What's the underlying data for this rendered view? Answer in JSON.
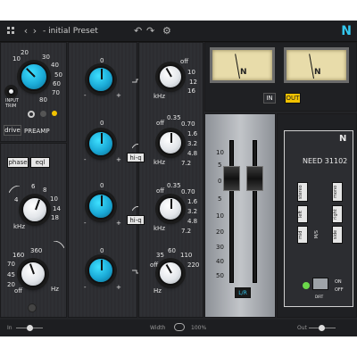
{
  "topbar": {
    "back_icon": "chevron-left",
    "forward_icon": "chevron-right",
    "preset_name": "- initial Preset",
    "undo_icon": "undo",
    "redo_icon": "redo",
    "settings_icon": "gear",
    "logo": "N"
  },
  "preamp": {
    "knob_ticks": [
      "10",
      "20",
      "30",
      "40",
      "50",
      "60",
      "70",
      "80"
    ],
    "input_trim_label": "INPUT\nTRIM",
    "drive_label": "drive",
    "preamp_label": "PREAMP"
  },
  "tone": {
    "phase_label": "phase",
    "eql_label": "eql",
    "hp_ticks": [
      "6",
      "8",
      "10",
      "14",
      "18",
      "4"
    ],
    "hp_unit": "kHz",
    "lp_ticks": [
      "160",
      "360",
      "70",
      "45",
      "20",
      "off"
    ],
    "lp_unit": "Hz"
  },
  "eq_gain": {
    "ticks": [
      "0",
      "-",
      "+"
    ],
    "band_count": 4
  },
  "eq_freq": {
    "hf_ticks": [
      "off",
      "10",
      "12",
      "16"
    ],
    "hf_unit": "kHz",
    "hmf_ticks": [
      "off",
      "0.35",
      "0.70",
      "1.6",
      "3.2",
      "4.8",
      "7.2"
    ],
    "hmf_unit": "kHz",
    "hi_q_label": "hi-q",
    "lmf_ticks": [
      "off",
      "0.35",
      "0.70",
      "1.6",
      "3.2",
      "4.8",
      "7.2"
    ],
    "lmf_unit": "kHz",
    "lf_ticks": [
      "35",
      "60",
      "110",
      "220",
      "off"
    ],
    "lf_unit": "Hz"
  },
  "meters": {
    "in_label": "IN",
    "out_label": "OUT",
    "vu_logo": "N",
    "vu_scale_left": [
      "-20",
      "-10",
      "-7",
      "-5",
      "-3",
      "-1",
      "0",
      "+1",
      "+3"
    ],
    "vu_scale_right": [
      "-20",
      "-10",
      "-7",
      "-5",
      "-3",
      "-1",
      "0",
      "+1",
      "+3"
    ]
  },
  "faders": {
    "scale": [
      "10",
      "5",
      "0",
      "5",
      "10",
      "20",
      "30",
      "40",
      "50"
    ],
    "link_label": "L/R"
  },
  "stereo": {
    "logo": "N",
    "model": "NEED 31102",
    "stereo_label": "stereo",
    "left_label": "left",
    "mid_label": "mid",
    "mono_label": "mono",
    "right_label": "right",
    "side_label": "side",
    "ms_label": "M/S",
    "dirt_label": "DIRT",
    "on_label": "ON",
    "off_label": "OFF"
  },
  "footer": {
    "in_label": "In",
    "width_label": "Width",
    "width_value": "100%",
    "out_label": "Out"
  }
}
